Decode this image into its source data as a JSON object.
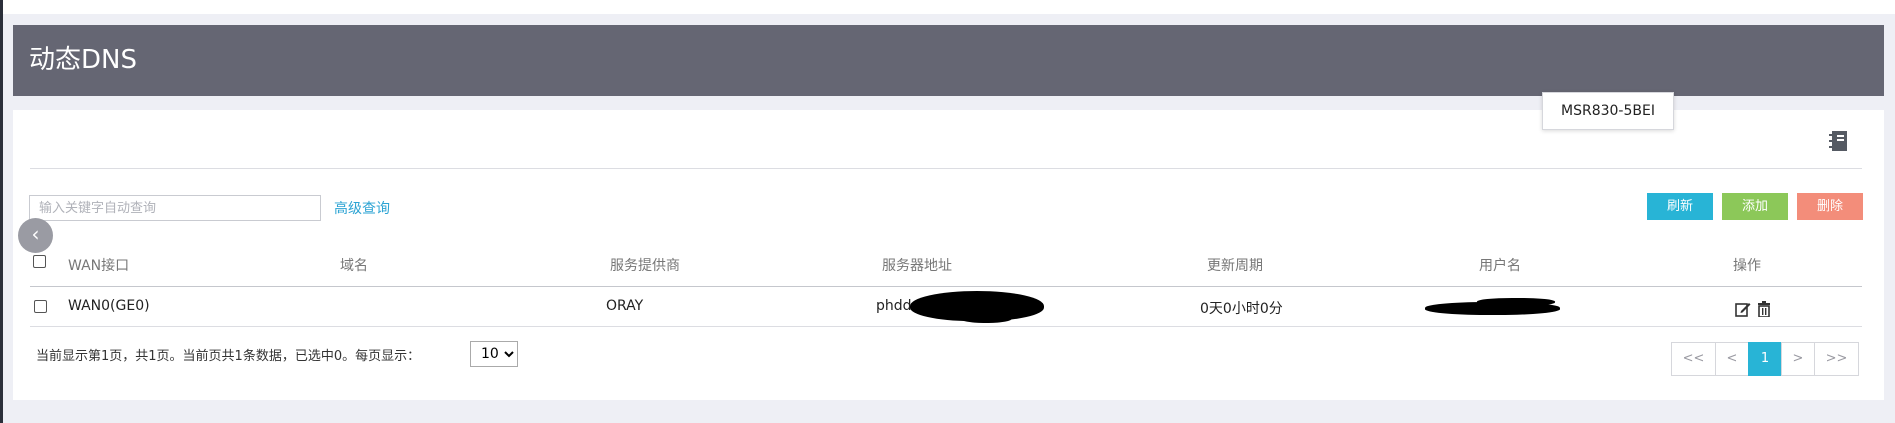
{
  "page_title": "动态DNS",
  "device_tooltip": "MSR830-5BEI",
  "search": {
    "placeholder": "输入关键字自动查询",
    "value": ""
  },
  "advanced_search_label": "高级查询",
  "toolbar": {
    "refresh_label": "刷新",
    "add_label": "添加",
    "delete_label": "删除"
  },
  "table": {
    "columns": [
      "WAN接口",
      "域名",
      "服务提供商",
      "服务器地址",
      "更新周期",
      "用户名",
      "操作"
    ],
    "rows": [
      {
        "wan": "WAN0(GE0)",
        "domain": "",
        "provider": "ORAY",
        "server": "phdd",
        "period": "0天0小时0分",
        "user": ""
      }
    ]
  },
  "footer": {
    "summary": "当前显示第1页，共1页。当前页共1条数据，已选中0。每页显示：",
    "page_size": "10"
  },
  "pagination": {
    "first": "<<",
    "prev": "<",
    "current": "1",
    "next": ">",
    "last": ">>"
  },
  "colors": {
    "header": "#656673",
    "refresh": "#28b4d6",
    "add": "#8cc859",
    "delete": "#f38d7a",
    "link": "#2ba3d3"
  }
}
